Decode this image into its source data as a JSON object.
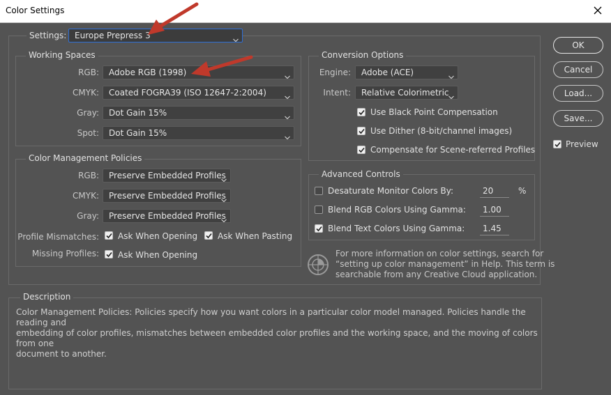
{
  "window": {
    "title": "Color Settings"
  },
  "settings": {
    "label": "Settings:",
    "value": "Europe Prepress 3"
  },
  "working_spaces": {
    "legend": "Working Spaces",
    "rows": [
      {
        "label": "RGB:",
        "value": "Adobe RGB (1998)"
      },
      {
        "label": "CMYK:",
        "value": "Coated FOGRA39 (ISO 12647-2:2004)"
      },
      {
        "label": "Gray:",
        "value": "Dot Gain 15%"
      },
      {
        "label": "Spot:",
        "value": "Dot Gain 15%"
      }
    ]
  },
  "policies": {
    "legend": "Color Management Policies",
    "rows": [
      {
        "label": "RGB:",
        "value": "Preserve Embedded Profiles"
      },
      {
        "label": "CMYK:",
        "value": "Preserve Embedded Profiles"
      },
      {
        "label": "Gray:",
        "value": "Preserve Embedded Profiles"
      }
    ],
    "profile_mismatches": {
      "label": "Profile Mismatches:",
      "ask_opening": "Ask When Opening",
      "ask_pasting": "Ask When Pasting"
    },
    "missing_profiles": {
      "label": "Missing Profiles:",
      "ask_opening": "Ask When Opening"
    }
  },
  "conversion": {
    "legend": "Conversion Options",
    "engine_label": "Engine:",
    "engine_value": "Adobe (ACE)",
    "intent_label": "Intent:",
    "intent_value": "Relative Colorimetric",
    "black_point": "Use Black Point Compensation",
    "dither": "Use Dither (8-bit/channel images)",
    "scene": "Compensate for Scene-referred Profiles"
  },
  "advanced": {
    "legend": "Advanced Controls",
    "desaturate": {
      "label": "Desaturate Monitor Colors By:",
      "value": "20",
      "unit": "%",
      "checked": false
    },
    "blend_rgb": {
      "label": "Blend RGB Colors Using Gamma:",
      "value": "1.00",
      "checked": false
    },
    "blend_text": {
      "label": "Blend Text Colors Using Gamma:",
      "value": "1.45",
      "checked": true
    }
  },
  "info": {
    "line1": "For more information on color settings, search for",
    "line2": "“setting up color management” in Help. This term is",
    "line3": "searchable from any Creative Cloud application."
  },
  "buttons": {
    "ok": "OK",
    "cancel": "Cancel",
    "load": "Load...",
    "save": "Save...",
    "preview": "Preview"
  },
  "description": {
    "legend": "Description",
    "line1": "Color Management Policies:  Policies specify how you want colors in a particular color model managed.  Policies handle the reading and",
    "line2": "embedding of color profiles, mismatches between embedded color profiles and the working space, and the moving of colors from one",
    "line3": "document to another."
  },
  "colors": {
    "background": "#535353",
    "annotation_arrow": "#c0392b",
    "focus": "#2f6fd6"
  },
  "icons": {
    "close": "close-icon",
    "chevron": "chevron-down-icon",
    "check": "check-icon",
    "info": "color-wheel-icon",
    "arrow": "red-arrow-annotation"
  }
}
